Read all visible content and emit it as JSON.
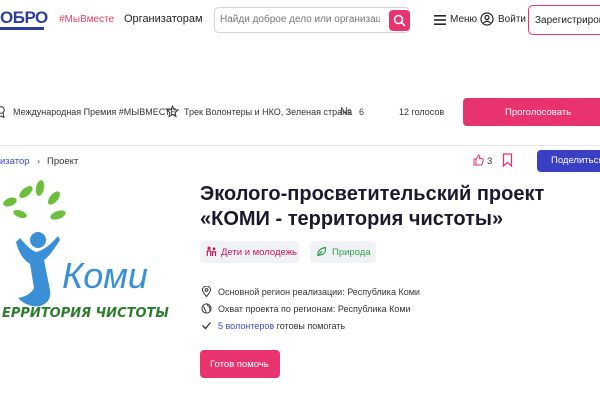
{
  "header": {
    "logo_text": "ОБРО",
    "hashtag": "#МыВместе",
    "organizers_link": "Организаторам",
    "search_placeholder": "Найди доброе дело или организацию",
    "menu_label": "Меню",
    "login_label": "Войти",
    "register_label": "Зарегистрирова"
  },
  "info_bar": {
    "award": "Международная Премия #МЫВМЕСТЕ",
    "track": "Трек Волонтеры и НКО, Зеленая страна",
    "number_sign": "№",
    "number": "6",
    "votes": "12 голосов",
    "vote_button": "Проголосовать"
  },
  "breadcrumb": {
    "organizer": "изатор",
    "separator": "›",
    "current": "Проект"
  },
  "actions": {
    "likes": "3",
    "share_button": "Поделиться"
  },
  "project": {
    "logo_title": "Коми",
    "logo_subtitle": "ЕРРИТОРИЯ ЧИСТОТЫ",
    "title_line1": "Эколого-просветительский проект",
    "title_line2": "«КОМИ - территория чистоты»",
    "tags": [
      "Дети и молодежь",
      "Природа"
    ],
    "main_region": "Основной регион реализации: Республика Коми",
    "coverage": "Охват проекта по регионам: Республика Коми",
    "volunteers_count": "5 волонтеров",
    "volunteers_suffix": "готовы помогать",
    "help_button": "Готов помочь"
  },
  "colors": {
    "accent": "#e8336e",
    "primary": "#3b3fc4",
    "brand_blue": "#2c3e9a",
    "leaf_green": "#6cbf3c",
    "logo_blue": "#3a8fd6"
  }
}
